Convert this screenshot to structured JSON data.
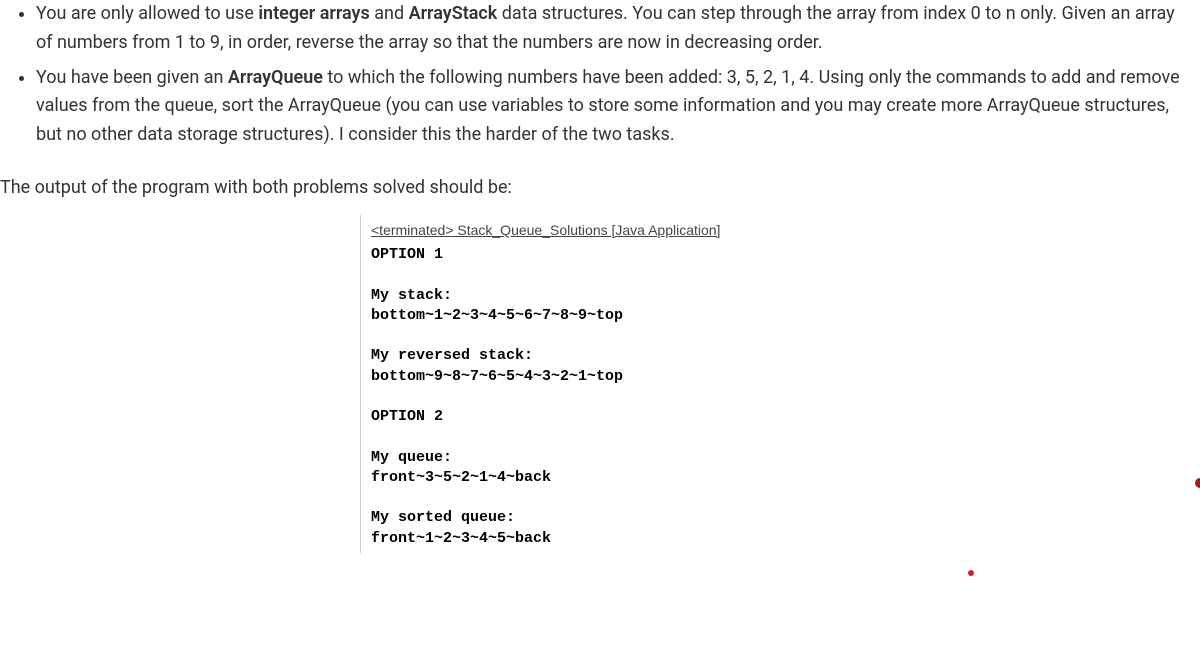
{
  "bullets": [
    {
      "pre": "You are only allowed to use ",
      "b1": "integer arrays",
      "mid1": " and ",
      "b2": "ArrayStack",
      "post": " data structures. You can step through the array from index 0 to n only. Given an array of numbers from 1 to 9, in order, reverse the array so that the numbers are now in decreasing order."
    },
    {
      "pre": "You have been given an ",
      "b1": "ArrayQueue",
      "mid1": "",
      "b2": "",
      "post": " to which the following numbers have been added: 3, 5, 2, 1, 4. Using only the commands to add and remove values from the queue, sort the ArrayQueue (you can use variables to store some information and you may create more ArrayQueue structures, but no other data storage structures). I consider this the harder of the two tasks."
    }
  ],
  "caption": "The output of the program with both problems solved should be:",
  "terminated": "<terminated> Stack_Queue_Solutions [Java Application]",
  "console": "OPTION 1\n\nMy stack:\nbottom~1~2~3~4~5~6~7~8~9~top\n\nMy reversed stack:\nbottom~9~8~7~6~5~4~3~2~1~top\n\nOPTION 2\n\nMy queue:\nfront~3~5~2~1~4~back\n\nMy sorted queue:\nfront~1~2~3~4~5~back"
}
